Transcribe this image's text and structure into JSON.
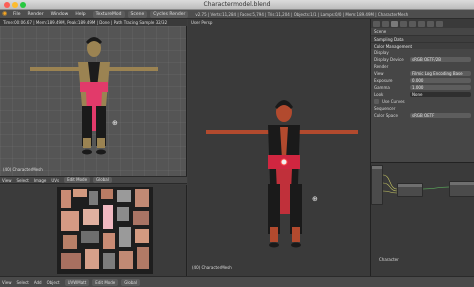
{
  "window": {
    "title": "Charactermodel.blend"
  },
  "menubar": {
    "items": [
      "File",
      "Render",
      "Window",
      "Help"
    ],
    "layout": "TextureMod",
    "scene": "Scene",
    "engine": "Cycles Render",
    "stats": "v2.75 | Verts:11,284 | Faces:5,794 | Tris:11,204 | Objects:1/1 | Lamps:0/0 | Mem:189.49M | CharacterMesh"
  },
  "uv_editor": {
    "status": "Time:00:06.67 | Mem:189.49M, Peak:189.49M | Done | Path Tracing Sample 32/32",
    "object_label": "(40) CharacterMesh",
    "header": {
      "items": [
        "View",
        "Select",
        "Image",
        "UVs"
      ],
      "mode": "Edit Mode",
      "pivot": "Global"
    }
  },
  "texture_view": {
    "header": {
      "items": [
        "View",
        "Select",
        "Add",
        "Node"
      ],
      "image": "UVWMatt"
    }
  },
  "viewport": {
    "label": "User Persp",
    "object_label": "(40) CharacterMesh",
    "header": {
      "items": [
        "View",
        "Select",
        "Add",
        "Object"
      ],
      "mode": "Edit Mode",
      "pivot": "Global"
    }
  },
  "properties": {
    "breadcrumb": "Scene",
    "panels": [
      {
        "title": "Sampling Data",
        "rows": []
      },
      {
        "title": "Color Management",
        "rows": [
          {
            "label": "Display",
            "value": ""
          },
          {
            "label": "Display Device",
            "value": "sRGB OETF/2B"
          },
          {
            "label": "Render",
            "value": ""
          },
          {
            "label": "View",
            "value": "Filmic Log Encoding Base"
          },
          {
            "label": "Exposure",
            "value": "0.000"
          },
          {
            "label": "Gamma",
            "value": "1.000"
          },
          {
            "label": "Look",
            "value": "None"
          }
        ]
      },
      {
        "title": "Use Curves",
        "rows": [
          {
            "label": "Sequencer",
            "value": ""
          },
          {
            "label": "Color Space",
            "value": "sRGB OETF"
          }
        ]
      }
    ]
  },
  "node_editor": {
    "label": "Character"
  },
  "bottombar": {
    "items": [
      "View",
      "Select",
      "Add",
      "Object"
    ],
    "fields": [
      "UVWMatt",
      "Edit Mode",
      "Global"
    ]
  },
  "colors": {
    "skin": "#9b8352",
    "cloth": "#e23a6a",
    "suit": "#1a1a1a",
    "accent": "#f5a623"
  }
}
